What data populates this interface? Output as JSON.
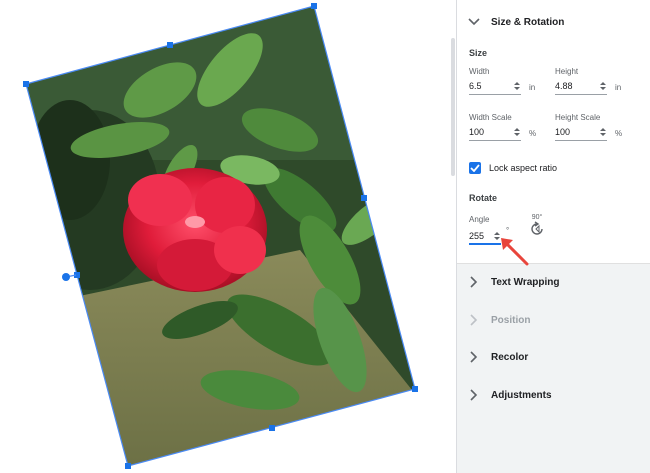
{
  "panel": {
    "size_rotation": {
      "title": "Size & Rotation",
      "size_label": "Size",
      "width_label": "Width",
      "width_value": "6.5",
      "width_unit": "in",
      "height_label": "Height",
      "height_value": "4.88",
      "height_unit": "in",
      "width_scale_label": "Width Scale",
      "width_scale_value": "100",
      "width_scale_unit": "%",
      "height_scale_label": "Height Scale",
      "height_scale_value": "100",
      "height_scale_unit": "%",
      "lock_label": "Lock aspect ratio",
      "lock_checked": true,
      "rotate_label": "Rotate",
      "angle_label": "Angle",
      "angle_value": "255",
      "angle_unit": "°",
      "rotate90_label": "90°"
    },
    "sections": [
      {
        "title": "Text Wrapping",
        "enabled": true
      },
      {
        "title": "Position",
        "enabled": false
      },
      {
        "title": "Recolor",
        "enabled": true
      },
      {
        "title": "Adjustments",
        "enabled": true
      }
    ]
  },
  "colors": {
    "accent": "#1a73e8",
    "arrow": "#e8453c",
    "flower": "#e0203a"
  },
  "icons": [
    "chevron-down-icon",
    "chevron-right-icon",
    "checkmark-icon",
    "spin-arrows-icon",
    "rotate-90-icon",
    "pointer-arrow-icon"
  ]
}
